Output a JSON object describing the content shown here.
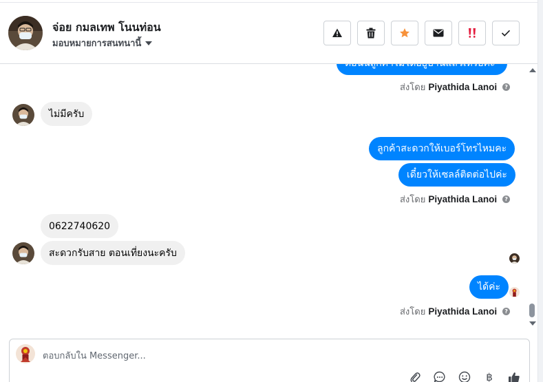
{
  "header": {
    "contact_name": "จ่อย กมลเทพ โนนท่อน",
    "assign_label": "มอบหมายการสนทนานี้",
    "actions": [
      {
        "name": "spam-button",
        "icon": "warning-icon"
      },
      {
        "name": "delete-button",
        "icon": "trash-icon"
      },
      {
        "name": "star-button",
        "icon": "star-icon"
      },
      {
        "name": "mark-unread-button",
        "icon": "envelope-icon"
      },
      {
        "name": "follow-up-button",
        "icon": "double-exclamation-icon"
      },
      {
        "name": "done-button",
        "icon": "checkmark-icon"
      }
    ]
  },
  "colors": {
    "outgoing_bubble": "#0084ff",
    "incoming_bubble": "#f0f0f0",
    "star": "#f7923b",
    "exclaim": "#e41e3f"
  },
  "messages": {
    "m0_partial": "ต้อนนี้ลูกค้าไม่ได้อยู่บ้านแล้วเหรอคะ",
    "m0_sender": "Piyathida Lanoi",
    "m1": "ไม่มีครับ",
    "m2": "ลูกค้าสะดวกให้เบอร์โทรไหมคะ",
    "m3": "เดี๋ยวให้เซลล์ติดต่อไปค่ะ",
    "m3_sender": "Piyathida Lanoi",
    "m4": "0622740620",
    "m5": "สะดวกรับสาย ตอนเที่ยงนะครับ",
    "m6": "ได้ค่ะ",
    "m6_sender": "Piyathida Lanoi",
    "sent_by_label": "ส่งโดย"
  },
  "composer": {
    "placeholder": "ตอบกลับใน Messenger...",
    "tools": [
      "paperclip-icon",
      "saved-reply-icon",
      "emoji-icon",
      "baht-icon",
      "thumbs-up-icon"
    ],
    "baht_symbol": "฿"
  }
}
